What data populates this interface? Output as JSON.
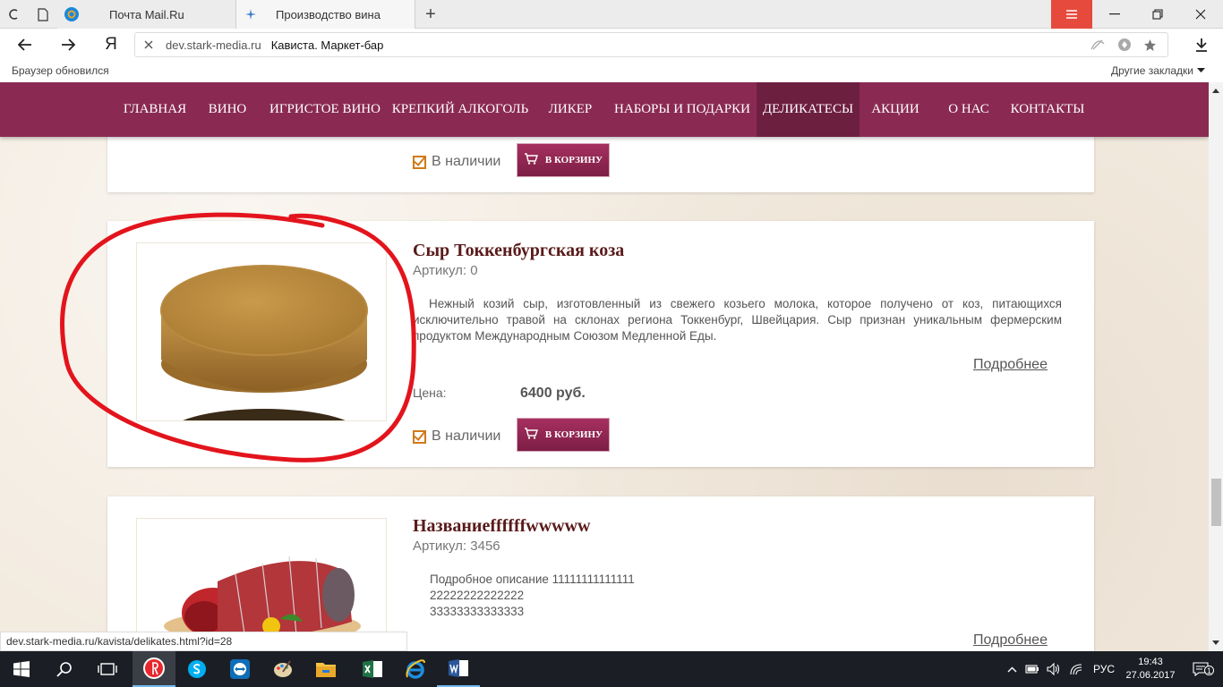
{
  "browser": {
    "tabs": [
      {
        "title": "Почта Mail.Ru"
      },
      {
        "title": "Производство вина"
      }
    ],
    "yandex_logo": "Я",
    "address": {
      "domain": "dev.stark-media.ru",
      "title": "Кависта. Маркет-бар"
    },
    "update_notice": "Браузер обновился",
    "other_bookmarks": "Другие закладки",
    "status_url": "dev.stark-media.ru/kavista/delikates.html?id=28"
  },
  "site": {
    "menu": [
      {
        "label": "ГЛАВНАЯ"
      },
      {
        "label": "ВИНО"
      },
      {
        "label": "ИГРИСТОЕ ВИНО"
      },
      {
        "label": "КРЕПКИЙ АЛКОГОЛЬ"
      },
      {
        "label": "ЛИКЕР"
      },
      {
        "label": "НАБОРЫ И ПОДАРКИ"
      },
      {
        "label": "ДЕЛИКАТЕСЫ",
        "active": true
      },
      {
        "label": "АКЦИИ"
      },
      {
        "label": "О НАС"
      },
      {
        "label": "КОНТАКТЫ"
      }
    ],
    "products": [
      {
        "stock": "В наличии",
        "cart_label": "В КОРЗИНУ"
      },
      {
        "title": "Сыр Токкенбургская коза",
        "article": "Артикул: 0",
        "description": "Нежный козий сыр, изготовленный из свежего козьего молока, которое получено от коз, питающихся исключительно травой на склонах региона Токкенбург, Швейцария. Сыр признан уникальным фермерским продуктом Международным Союзом Медленной Еды.",
        "more": "Подробнее",
        "price_label": "Цена:",
        "price": "6400 руб.",
        "stock": "В наличии",
        "cart_label": "В КОРЗИНУ"
      },
      {
        "title": "Названиеffffffwwwww",
        "article": "Артикул: 3456",
        "description_lines": [
          "Подробное описание 11111111111111",
          "22222222222222",
          "33333333333333"
        ],
        "more": "Подробнее"
      }
    ]
  },
  "taskbar": {
    "language": "РУС",
    "time": "19:43",
    "date": "27.06.2017",
    "notifications": "1"
  },
  "colors": {
    "brand": "#8a2a52",
    "brand_active": "#6d1f40",
    "title": "#5a1a1a",
    "annotation": "#e3141c"
  }
}
